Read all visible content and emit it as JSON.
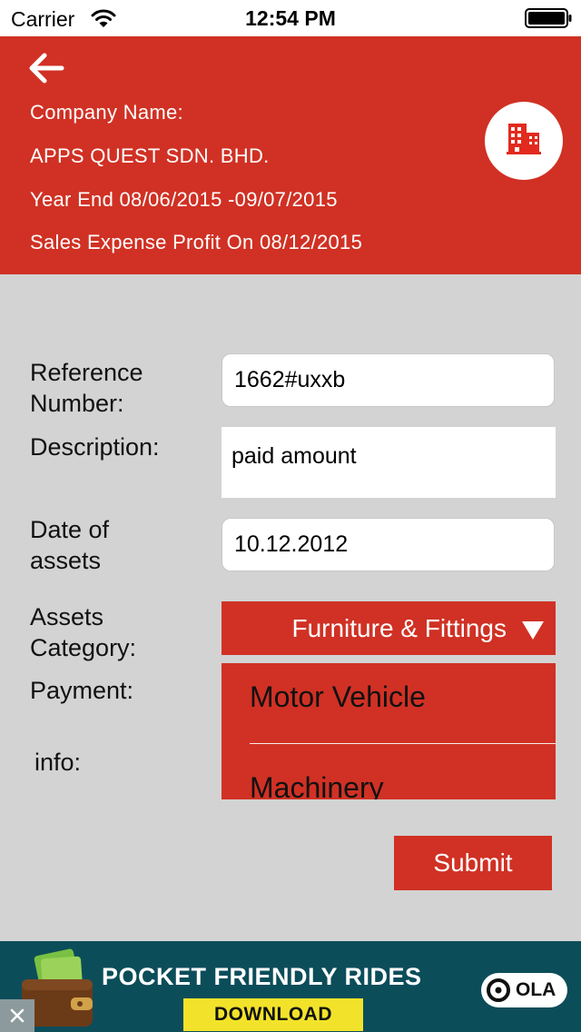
{
  "status_bar": {
    "carrier": "Carrier",
    "time": "12:54 PM",
    "icons": [
      "wifi-icon",
      "battery-icon"
    ]
  },
  "header": {
    "back_icon": "back-arrow-icon",
    "company_label": "Company Name:",
    "company_name": "APPS QUEST SDN. BHD.",
    "year_end": "Year End 08/06/2015 -09/07/2015",
    "report_title": "Sales Expense Profit On 08/12/2015",
    "badge_icon": "building-icon",
    "color": "#d03124"
  },
  "form": {
    "reference_label": "Reference\nNumber:",
    "reference_value": "1662#uxxb",
    "description_label": "Description:",
    "description_value": "paid amount",
    "date_label": "Date of\nassets",
    "date_value": "10.12.2012",
    "assets_category_label": "Assets\nCategory:",
    "assets_category_selected": "Furniture & Fittings",
    "assets_category_options": [
      "Motor Vehicle",
      "Machinery"
    ],
    "payment_label": "Payment:",
    "info_label": "info:",
    "submit_label": "Submit"
  },
  "ad": {
    "headline": "POCKET FRIENDLY RIDES",
    "cta": "DOWNLOAD",
    "brand": "OLA",
    "icons": [
      "wallet-icon",
      "ola-logo",
      "close-icon"
    ]
  }
}
